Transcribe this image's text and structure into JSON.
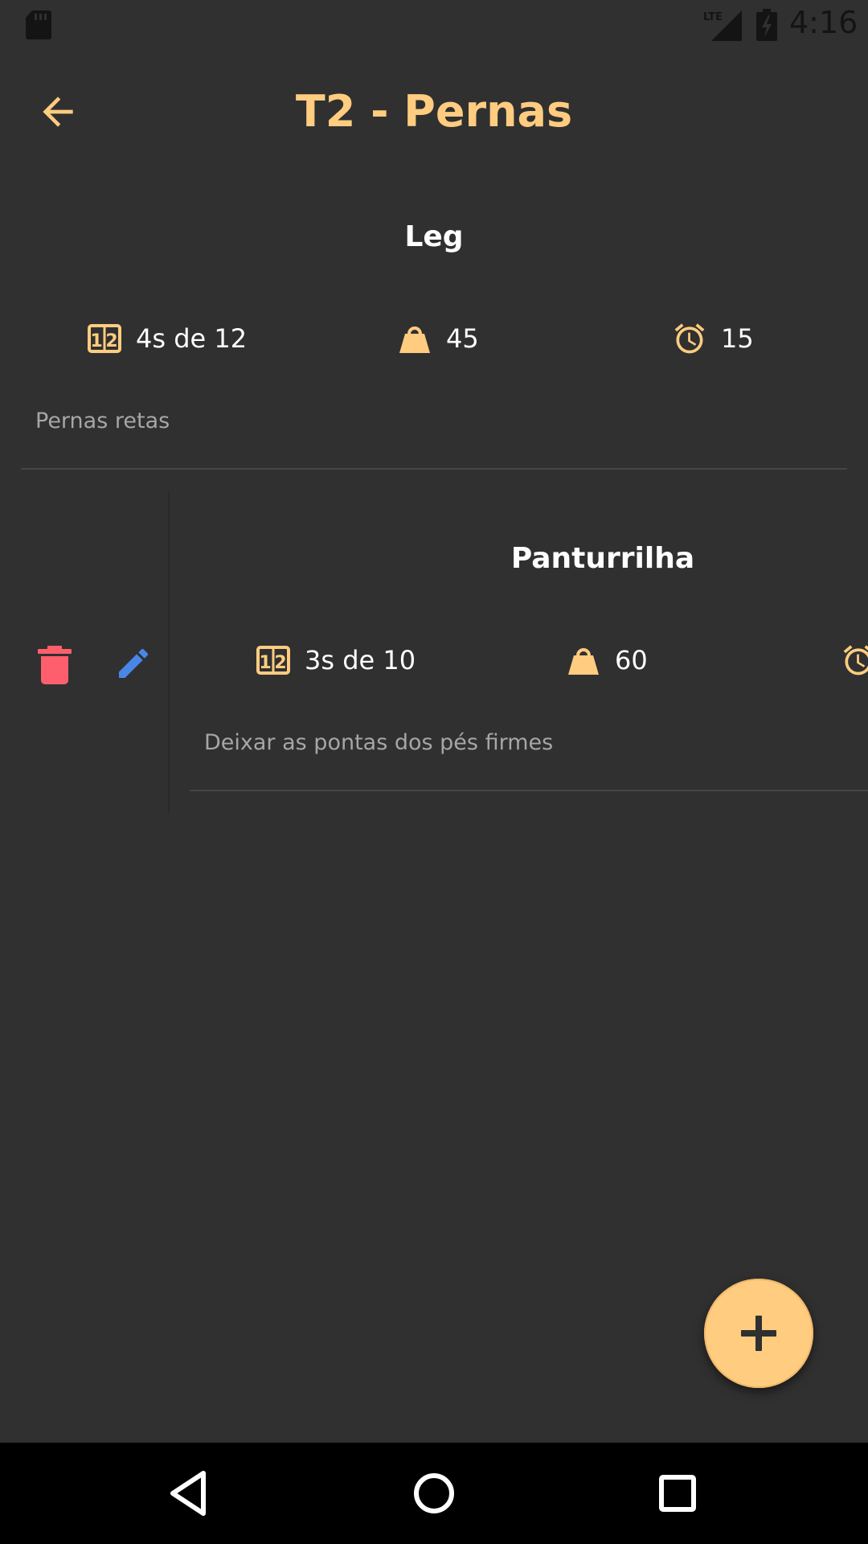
{
  "status_bar": {
    "time": "4:16",
    "network_label": "LTE",
    "icons": [
      "sd-card-icon",
      "lte-signal-icon",
      "battery-charging-icon"
    ]
  },
  "toolbar": {
    "title": "T2 - Pernas",
    "back_icon": "arrow-back-icon"
  },
  "exercises": [
    {
      "name": "Leg",
      "sets": "4s de 12",
      "weight": "45",
      "rest": "15",
      "notes": "Pernas retas"
    },
    {
      "name": "Panturrilha",
      "sets": "3s de 10",
      "weight": "60",
      "rest": "",
      "notes": "Deixar as pontas dos pés firmes"
    }
  ],
  "swipe_actions": {
    "delete_icon": "delete-icon",
    "edit_icon": "edit-icon"
  },
  "fab": {
    "icon": "plus-icon"
  },
  "nav_bar": {
    "icons": [
      "back-triangle-icon",
      "home-circle-icon",
      "recents-square-icon"
    ]
  },
  "colors": {
    "background": "#303030",
    "accent": "#ffcc80",
    "delete": "#ff5f6d",
    "edit": "#4a86e8",
    "note_text": "#a6a6a6",
    "divider": "#464646",
    "nav_bar": "#000000"
  }
}
